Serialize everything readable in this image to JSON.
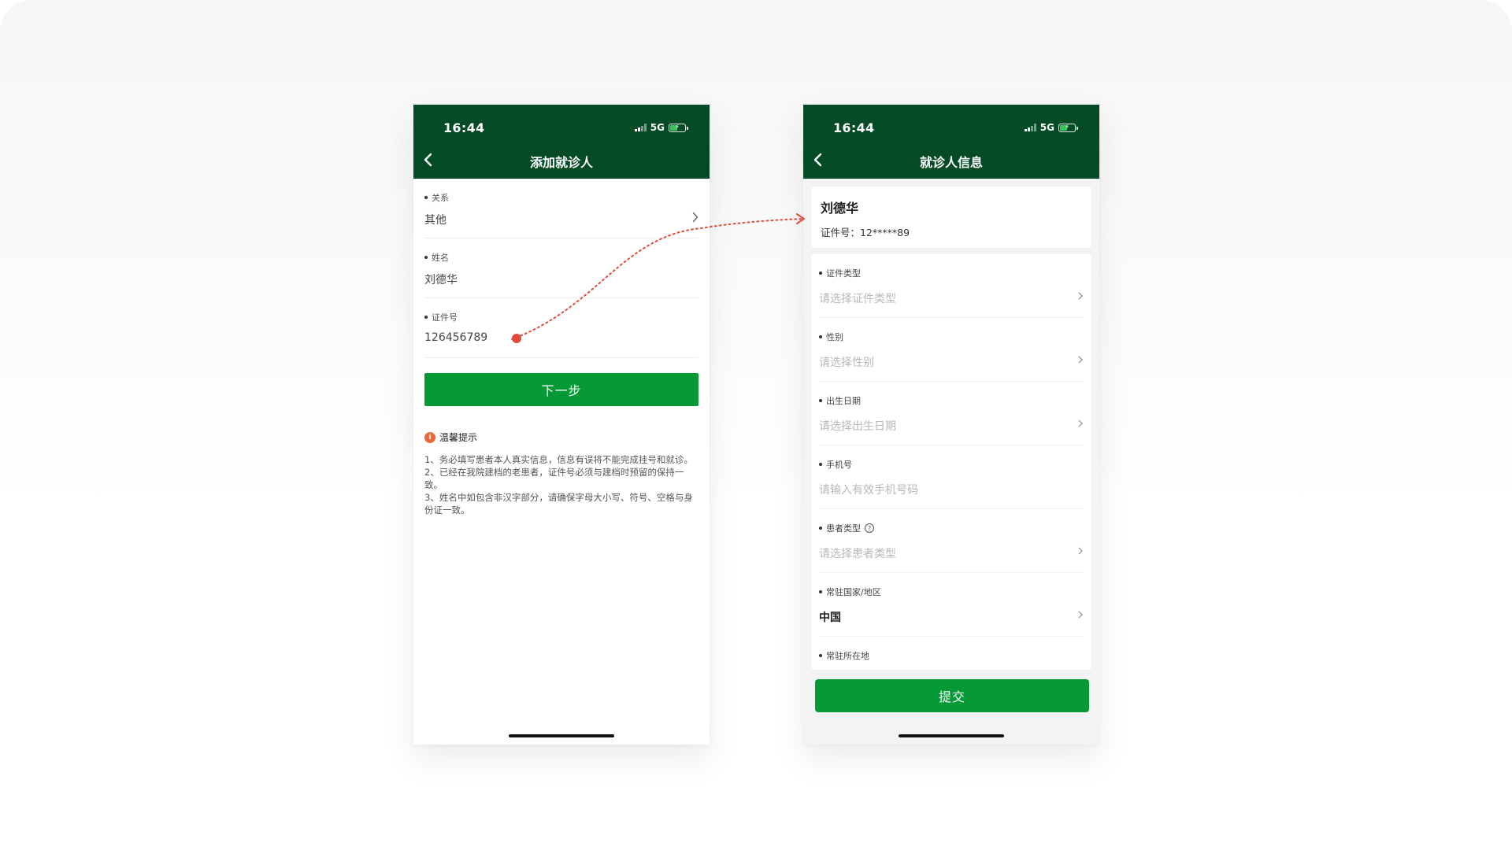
{
  "left_screen": {
    "status": {
      "time": "16:44",
      "network": "5G"
    },
    "nav": {
      "title": "添加就诊人"
    },
    "fields": [
      {
        "label": "关系",
        "value": "其他"
      },
      {
        "label": "姓名",
        "value": "刘德华"
      },
      {
        "label": "证件号",
        "value": "126456789"
      }
    ],
    "next_button": "下一步",
    "tips": {
      "heading": "温馨提示",
      "icon_char": "i",
      "lines": [
        "1、务必填写患者本人真实信息，信息有误将不能完成挂号和就诊。",
        "2、已经在我院建档的老患者，证件号必须与建档时预留的保持一致。",
        "3、姓名中如包含非汉字部分，请确保字母大小写、符号、空格与身份证一致。"
      ]
    }
  },
  "right_screen": {
    "status": {
      "time": "16:44",
      "network": "5G"
    },
    "nav": {
      "title": "就诊人信息"
    },
    "patient": {
      "name": "刘德华",
      "id_label": "证件号：",
      "id_value": "12*****89"
    },
    "fields": [
      {
        "label": "证件类型",
        "placeholder": "请选择证件类型"
      },
      {
        "label": "性别",
        "placeholder": "请选择性别"
      },
      {
        "label": "出生日期",
        "placeholder": "请选择出生日期"
      },
      {
        "label": "手机号",
        "placeholder": "请输入有效手机号码"
      },
      {
        "label": "患者类型",
        "placeholder": "请选择患者类型",
        "help_char": "?"
      },
      {
        "label": "常驻国家/地区",
        "value": "中国"
      },
      {
        "label": "常驻所在地"
      }
    ],
    "submit_button": "提交"
  },
  "colors": {
    "header_green": "#024b24",
    "button_green": "#069a37",
    "connector_red": "#e24b3b",
    "tip_orange": "#e9693a"
  },
  "icons": [
    "chevron-left-icon",
    "chevron-right-icon",
    "signal-icon",
    "battery-icon",
    "info-icon",
    "help-icon"
  ]
}
